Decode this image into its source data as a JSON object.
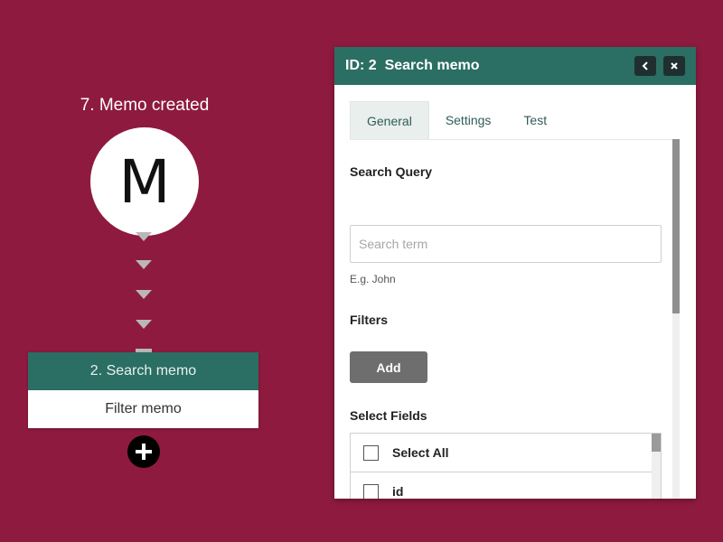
{
  "workflow": {
    "node_title": "7. Memo created",
    "node_letter": "M",
    "step_menu": {
      "active_item": "2. Search memo",
      "second_item": "Filter memo"
    }
  },
  "panel": {
    "title": "ID: 2  Search memo",
    "tabs": [
      "General",
      "Settings",
      "Test"
    ],
    "active_tab": "General",
    "search_query": {
      "label": "Search Query",
      "placeholder": "Search term",
      "value": "",
      "hint": "E.g. John"
    },
    "filters": {
      "label": "Filters",
      "add_label": "Add"
    },
    "select_fields": {
      "label": "Select Fields",
      "rows": [
        "Select All",
        "id"
      ]
    }
  },
  "colors": {
    "background": "#8e1a3f",
    "accent": "#2b6e63",
    "header_button": "#1f2f30"
  },
  "icons": {
    "back": "chevron-left-icon",
    "close": "close-icon",
    "add_step": "plus-circle-icon",
    "flow": "arrow-down-icon"
  }
}
